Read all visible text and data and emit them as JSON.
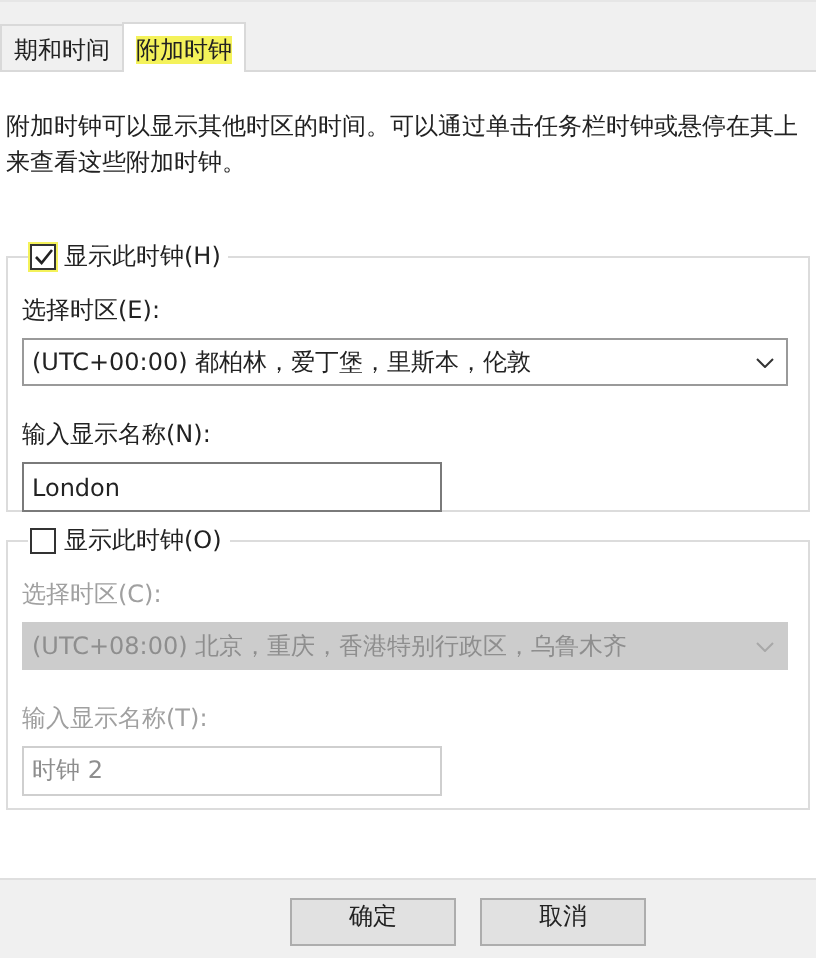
{
  "tabs": [
    {
      "label": "期和时间",
      "selected": false,
      "highlighted": false
    },
    {
      "label": "附加时钟",
      "selected": true,
      "highlighted": true
    }
  ],
  "description": "附加时钟可以显示其他时区的时间。可以通过单击任务栏时钟或悬停在其上来查看这些附加时钟。",
  "clocks": [
    {
      "show_label": "显示此时钟(H)",
      "checked": true,
      "highlighted": true,
      "timezone_label": "选择时区(E):",
      "timezone": "(UTC+00:00) 都柏林，爱丁堡，里斯本，伦敦",
      "name_label": "输入显示名称(N):",
      "name": "London"
    },
    {
      "show_label": "显示此时钟(O)",
      "checked": false,
      "highlighted": false,
      "timezone_label": "选择时区(C):",
      "timezone": "(UTC+08:00) 北京，重庆，香港特别行政区，乌鲁木齐",
      "name_label": "输入显示名称(T):",
      "name": "时钟 2"
    }
  ],
  "buttons": [
    "确定",
    "取消"
  ]
}
